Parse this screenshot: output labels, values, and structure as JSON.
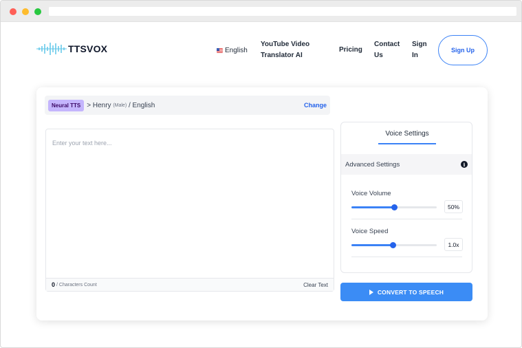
{
  "brand": {
    "name": "TTSVOX"
  },
  "nav": {
    "language": "English",
    "youtube": "YouTube Video Translator AI",
    "pricing": "Pricing",
    "contact": "Contact Us",
    "signin": "Sign In",
    "signup": "Sign Up"
  },
  "voice": {
    "engine_badge": "Neural TTS",
    "prefix": "> Henry",
    "gender": "(Male)",
    "language": "/ English",
    "change": "Change"
  },
  "editor": {
    "placeholder": "Enter your text here...",
    "char_count": "0",
    "char_label": "/ Characters Count",
    "clear": "Clear Text"
  },
  "settings": {
    "tab": "Voice Settings",
    "advanced": "Advanced Settings",
    "info_icon": "info-icon",
    "volume": {
      "label": "Voice Volume",
      "value_text": "50%",
      "fraction": 0.5
    },
    "speed": {
      "label": "Voice Speed",
      "value_text": "1.0x",
      "fraction": 0.48
    }
  },
  "convert": {
    "label": "CONVERT TO SPEECH",
    "icon": "play-icon"
  },
  "colors": {
    "accent": "#3b82f6",
    "badge": "#c4b5fd",
    "button": "#3b8cf5"
  }
}
